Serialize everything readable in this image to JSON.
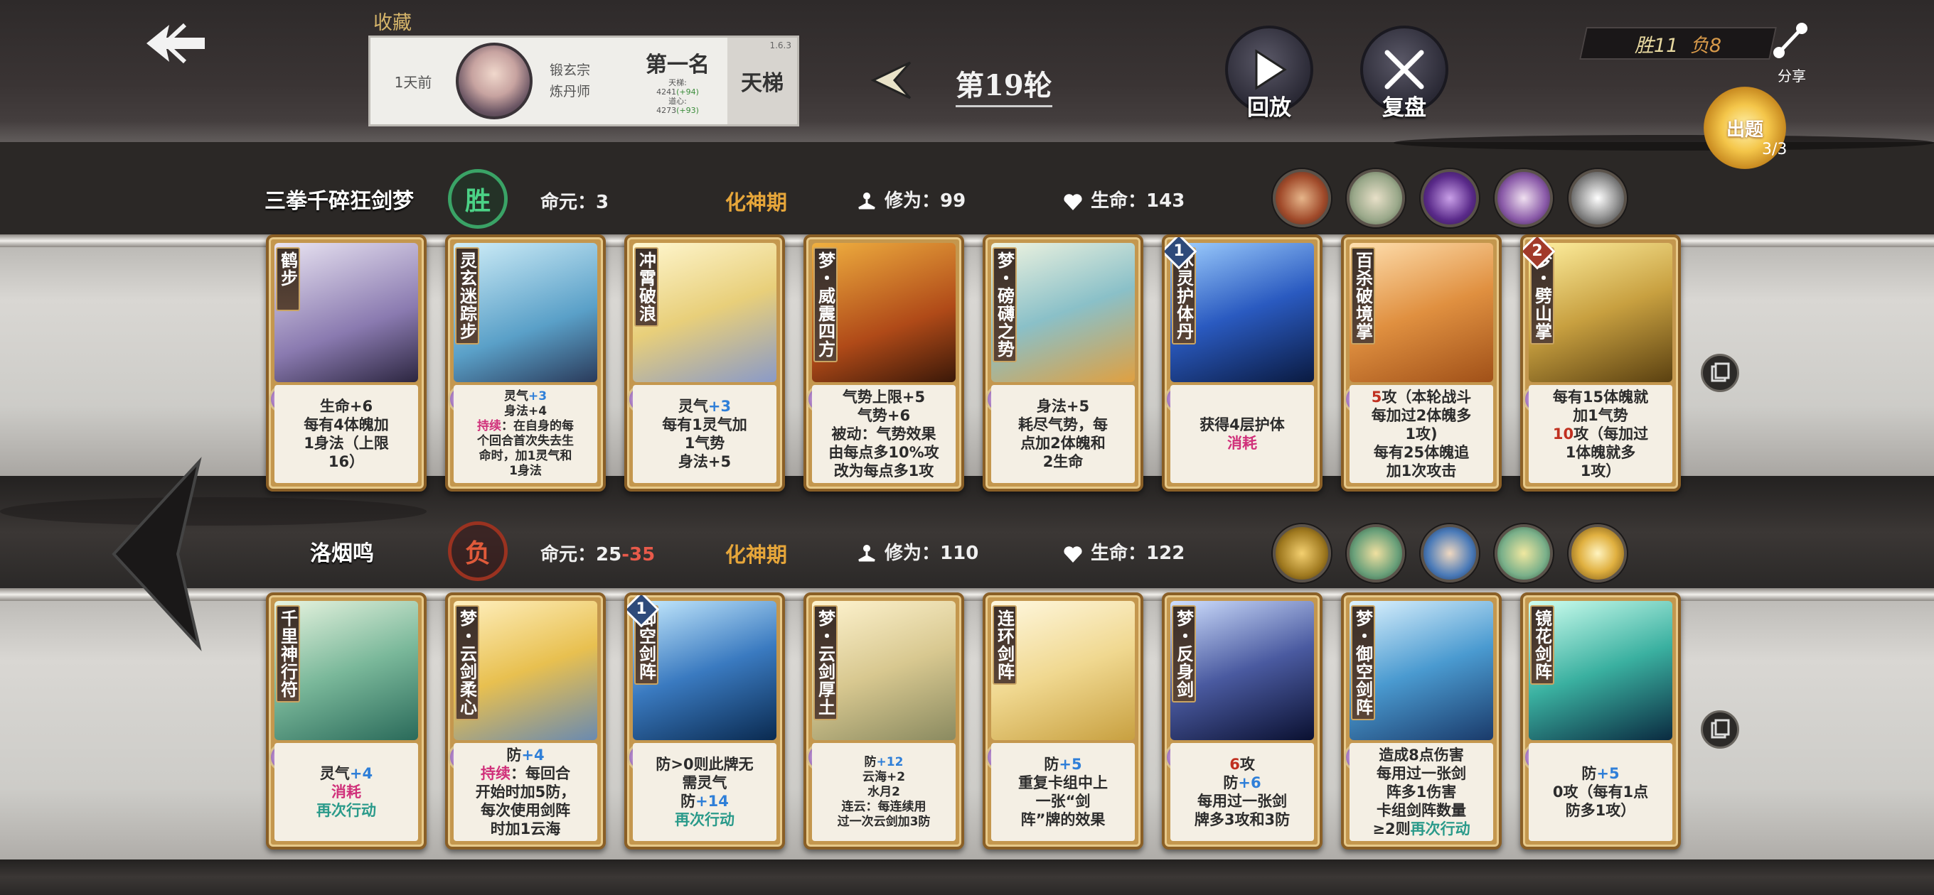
{
  "header": {
    "collect_label": "收藏",
    "record": {
      "time": "1天前",
      "sect_line1": "锻玄宗",
      "sect_line2": "炼丹师",
      "rank_title": "第一名",
      "rank_line1": "天梯:",
      "rank_line2_value": "4241",
      "rank_line2_delta": "(+94)",
      "rank_line3": "道心:",
      "rank_line4_value": "4273",
      "rank_line4_delta": "(+93)",
      "mode": "天梯",
      "version": "1.6.3"
    },
    "round_label": "第19轮",
    "replay_label": "回放",
    "review_label": "复盘",
    "score_win": "胜11",
    "score_loss": "负8",
    "share_label": "分享",
    "puzzle_label": "出题",
    "puzzle_count": "3/3"
  },
  "player1": {
    "name": "三拳千碎狂剑梦",
    "result": "胜",
    "destiny_label": "命元：",
    "destiny_value": "3",
    "realm": "化神期",
    "cultivation_label": "修为：",
    "cultivation_value": "99",
    "health_label": "生命：",
    "health_value": "143",
    "cards": [
      {
        "name": "鹤步",
        "lines": [
          [
            "生命+6"
          ],
          [
            "每有4体魄加"
          ],
          [
            "1身法（上限"
          ],
          [
            "16）"
          ]
        ]
      },
      {
        "name": "灵玄迷踪步",
        "lines": [
          [
            "灵气",
            {
              "t": "+3",
              "c": "blue"
            }
          ],
          [
            "身法+4"
          ],
          [
            {
              "t": "持续",
              "c": "pink"
            },
            "：在自身的每"
          ],
          [
            "个回合首次失去生"
          ],
          [
            "命时，加1灵气和"
          ],
          [
            "1身法"
          ]
        ],
        "small": true
      },
      {
        "name": "冲霄破浪",
        "lines": [
          [
            "灵气",
            {
              "t": "+3",
              "c": "blue"
            }
          ],
          [
            "每有1灵气加"
          ],
          [
            "1气势"
          ],
          [
            "身法+5"
          ]
        ]
      },
      {
        "name": "梦・威震四方",
        "lines": [
          [
            "气势上限+5"
          ],
          [
            "气势+6"
          ],
          [
            "被动：气势效果"
          ],
          [
            "由每点多10%攻"
          ],
          [
            "改为每点多1攻"
          ]
        ]
      },
      {
        "name": "梦・磅礴之势",
        "lines": [
          [
            "身法+5"
          ],
          [
            "耗尽气势，每"
          ],
          [
            "点加2体魄和"
          ],
          [
            "2生命"
          ]
        ]
      },
      {
        "name": "冰灵护体丹",
        "cost": "1",
        "lines": [
          [
            "获得4层护体"
          ],
          [
            {
              "t": "消耗",
              "c": "pink"
            }
          ]
        ]
      },
      {
        "name": "百杀破境掌",
        "lines": [
          [
            {
              "t": "5",
              "c": "red"
            },
            "攻（本轮战斗"
          ],
          [
            "每加过2体魄多"
          ],
          [
            "1攻)"
          ],
          [
            "每有25体魄追"
          ],
          [
            "加1次攻击"
          ]
        ]
      },
      {
        "name": "梦・劈山掌",
        "cost": "2",
        "cost_color": "red",
        "lines": [
          [
            "每有15体魄就"
          ],
          [
            "加1气势"
          ],
          [
            {
              "t": "10",
              "c": "red"
            },
            "攻（每加过"
          ],
          [
            "1体魄就多"
          ],
          [
            "1攻）"
          ]
        ]
      }
    ]
  },
  "player2": {
    "name": "洛烟鸣",
    "result": "负",
    "destiny_label": "命元：",
    "destiny_value": "25",
    "destiny_delta": "-35",
    "realm": "化神期",
    "cultivation_label": "修为：",
    "cultivation_value": "110",
    "health_label": "生命：",
    "health_value": "122",
    "cards": [
      {
        "name": "千里神行符",
        "lines": [
          [
            "灵气",
            {
              "t": "+4",
              "c": "blue"
            }
          ],
          [
            {
              "t": "消耗",
              "c": "pink"
            }
          ],
          [
            {
              "t": "再次行动",
              "c": "teal"
            }
          ]
        ]
      },
      {
        "name": "梦・云剑柔心",
        "lines": [
          [
            "防",
            {
              "t": "+4",
              "c": "blue"
            }
          ],
          [
            {
              "t": "持续",
              "c": "pink"
            },
            "：每回合"
          ],
          [
            "开始时加5防，"
          ],
          [
            "每次使用剑阵"
          ],
          [
            "时加1云海"
          ]
        ]
      },
      {
        "name": "御空剑阵",
        "cost": "1",
        "lines": [
          [
            "防>0则此牌无"
          ],
          [
            "需灵气"
          ],
          [
            "防",
            {
              "t": "+14",
              "c": "blue"
            }
          ],
          [
            {
              "t": "再次行动",
              "c": "teal"
            }
          ]
        ]
      },
      {
        "name": "梦・云剑厚土",
        "lines": [
          [
            "防",
            {
              "t": "+12",
              "c": "blue"
            }
          ],
          [
            "云海+2"
          ],
          [
            "水月2"
          ],
          [
            "连云：每连续用"
          ],
          [
            "过一次云剑加3防"
          ]
        ],
        "small": true
      },
      {
        "name": "连环剑阵",
        "lines": [
          [
            "防",
            {
              "t": "+5",
              "c": "blue"
            }
          ],
          [
            "重复卡组中上"
          ],
          [
            "一张“剑"
          ],
          [
            "阵”牌的效果"
          ]
        ]
      },
      {
        "name": "梦・反身剑",
        "lines": [
          [
            {
              "t": "6",
              "c": "red"
            },
            "攻"
          ],
          [
            "防",
            {
              "t": "+6",
              "c": "blue"
            }
          ],
          [
            "每用过一张剑"
          ],
          [
            "牌多3攻和3防"
          ]
        ]
      },
      {
        "name": "梦・御空剑阵",
        "lines": [
          [
            "造成8点伤害"
          ],
          [
            "每用过一张剑"
          ],
          [
            "阵多1伤害"
          ],
          [
            "卡组剑阵数量"
          ],
          [
            "≥2则",
            {
              "t": "再次行动",
              "c": "teal"
            }
          ]
        ]
      },
      {
        "name": "镜花剑阵",
        "lines": [
          [
            "防",
            {
              "t": "+5",
              "c": "blue"
            }
          ],
          [
            "0攻（每有1点"
          ],
          [
            "防多1攻）"
          ]
        ]
      }
    ]
  },
  "colors": {
    "win": "#4bd286",
    "lose": "#e05a3a",
    "realm": "#e6a63a",
    "card_gold": "#c4974e"
  },
  "icons": {
    "back": "double-left-arrow-icon",
    "round_prev": "chevron-left-icon",
    "replay": "play-icon",
    "review": "crossed-swords-icon",
    "share": "share-icon",
    "cultivation": "meditating-figure-icon",
    "health": "heart-drop-icon",
    "deck": "card-deck-icon"
  }
}
